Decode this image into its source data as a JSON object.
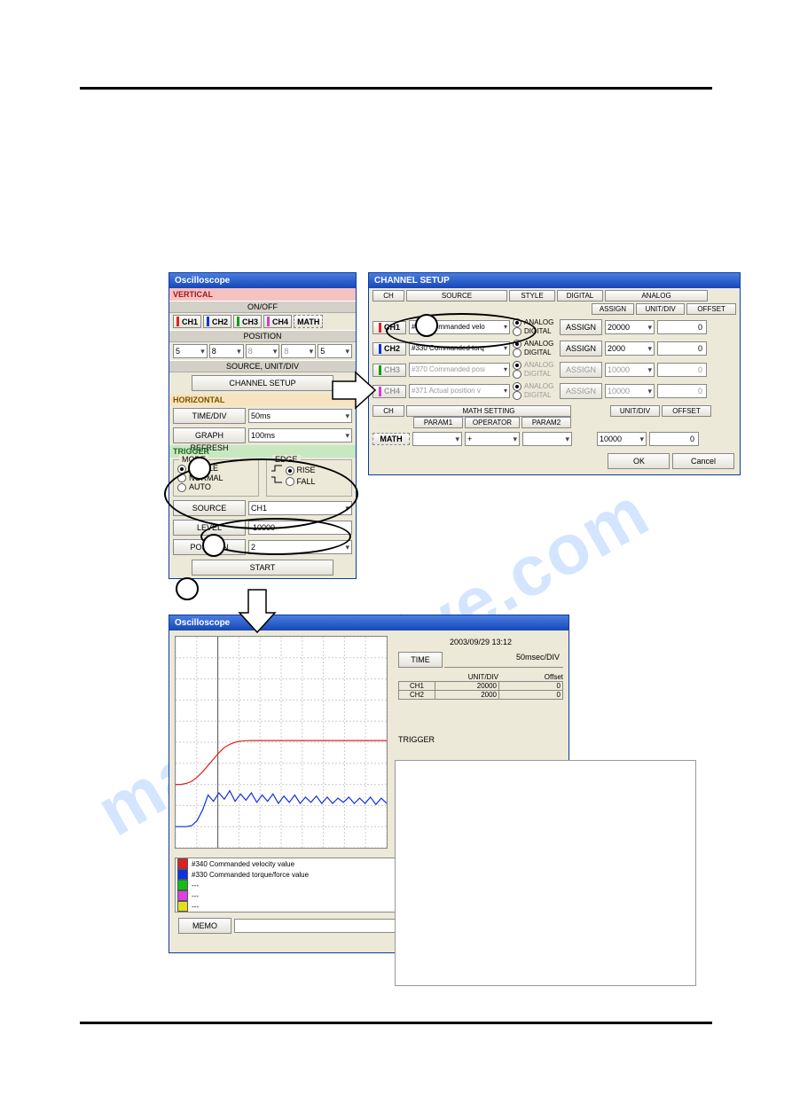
{
  "watermark": "manualshive.com",
  "osc_panel": {
    "title": "Oscilloscope",
    "vertical_label": "VERTICAL",
    "onoff_label": "ON/OFF",
    "ch_buttons": [
      "CH1",
      "CH2",
      "CH3",
      "CH4",
      "MATH"
    ],
    "position_label": "POSITION",
    "pos_values": [
      "5",
      "8",
      "8",
      "8",
      "5"
    ],
    "source_unitdiv_label": "SOURCE, UNIT/DIV",
    "channel_setup_btn": "CHANNEL SETUP",
    "horizontal_label": "HORIZONTAL",
    "time_div_label": "TIME/DIV",
    "time_div_value": "50ms",
    "graph_refresh_label": "GRAPH REFRESH",
    "graph_refresh_value": "100ms",
    "trigger_label": "TRIGGER",
    "mode_label": "MODE",
    "mode_single": "SINGLE",
    "mode_normal": "NORMAL",
    "mode_auto": "AUTO",
    "edge_label": "EDGE",
    "edge_rise": "RISE",
    "edge_fall": "FALL",
    "source_label": "SOURCE",
    "source_value": "CH1",
    "level_label": "LEVEL",
    "level_value": "10000",
    "position2_label": "POSITION",
    "position2_value": "2",
    "start_btn": "START"
  },
  "channel_setup": {
    "title": "CHANNEL SETUP",
    "headers": {
      "ch": "CH",
      "source": "SOURCE",
      "style": "STYLE",
      "digital": "DIGITAL",
      "analog": "ANALOG",
      "assign": "ASSIGN",
      "unitdiv": "UNIT/DIV",
      "offset": "OFFSET"
    },
    "rows": [
      {
        "ch": "CH1",
        "color": "#e02020",
        "src": "#340  Commanded velo",
        "style_analog": "ANALOG",
        "style_digital": "DIGITAL",
        "analog_on": true,
        "assign": "ASSIGN",
        "unitdiv": "20000",
        "offset": "0",
        "enabled": true
      },
      {
        "ch": "CH2",
        "color": "#1030e0",
        "src": "#330  Commanded torq",
        "style_analog": "ANALOG",
        "style_digital": "DIGITAL",
        "analog_on": true,
        "assign": "ASSIGN",
        "unitdiv": "2000",
        "offset": "0",
        "enabled": true
      },
      {
        "ch": "CH3",
        "color": "#10a010",
        "src": "#370  Commanded posi",
        "style_analog": "ANALOG",
        "style_digital": "DIGITAL",
        "analog_on": true,
        "assign": "ASSIGN",
        "unitdiv": "10000",
        "offset": "0",
        "enabled": false
      },
      {
        "ch": "CH4",
        "color": "#d040d0",
        "src": "#371  Actual position v",
        "style_analog": "ANALOG",
        "style_digital": "DIGITAL",
        "analog_on": true,
        "assign": "ASSIGN",
        "unitdiv": "10000",
        "offset": "0",
        "enabled": false
      }
    ],
    "math_headers": {
      "ch": "CH",
      "math_setting": "MATH SETTING",
      "param1": "PARAM1",
      "operator": "OPERATOR",
      "param2": "PARAM2",
      "unitdiv": "UNIT/DIV",
      "offset": "OFFSET"
    },
    "math_row": {
      "ch": "MATH",
      "param1": "",
      "operator": "+",
      "param2": "",
      "unitdiv": "10000",
      "offset": "0"
    },
    "ok_btn": "OK",
    "cancel_btn": "Cancel"
  },
  "scope_result": {
    "title": "Oscilloscope",
    "timestamp": "2003/09/29 13:12",
    "time_label": "TIME",
    "time_value": "50msec/DIV",
    "col_unitdiv": "UNIT/DIV",
    "col_offset": "Offset",
    "rows": [
      {
        "ch": "CH1",
        "unitdiv": "20000",
        "offset": "0"
      },
      {
        "ch": "CH2",
        "unitdiv": "2000",
        "offset": "0"
      }
    ],
    "trigger_label": "TRIGGER",
    "legend": [
      {
        "color": "#e02020",
        "text": "#340  Commanded velocity value"
      },
      {
        "color": "#1030e0",
        "text": "#330  Commanded torque/force value"
      },
      {
        "color": "#10c010",
        "text": "---"
      },
      {
        "color": "#e040e0",
        "text": "---"
      },
      {
        "color": "#e0e020",
        "text": "---"
      }
    ],
    "memo_label": "MEMO"
  },
  "chart_data": {
    "type": "line",
    "x": {
      "label": "",
      "range": [
        0,
        10
      ],
      "unit": "50msec/DIV",
      "gridlines": 10
    },
    "y": {
      "label": "",
      "range": [
        0,
        10
      ],
      "gridlines": 10
    },
    "trigger_position_div": 2,
    "series": [
      {
        "name": "CH1 #340 Commanded velocity value",
        "color": "#e02020",
        "unit_per_div": 20000,
        "offset": 0,
        "values_div": [
          3.0,
          3.0,
          3.05,
          3.15,
          3.35,
          3.6,
          3.9,
          4.2,
          4.5,
          4.75,
          4.9,
          5.0,
          5.05,
          5.07,
          5.08,
          5.08,
          5.08,
          5.08,
          5.08,
          5.08,
          5.08,
          5.08,
          5.08,
          5.08,
          5.08,
          5.08,
          5.08,
          5.08,
          5.08,
          5.08,
          5.08,
          5.08,
          5.08,
          5.08,
          5.08,
          5.08,
          5.08,
          5.08,
          5.08,
          5.08
        ]
      },
      {
        "name": "CH2 #330 Commanded torque/force value",
        "color": "#1030e0",
        "unit_per_div": 2000,
        "offset": 0,
        "values_div": [
          1.0,
          1.0,
          1.0,
          1.05,
          1.3,
          1.8,
          2.5,
          2.2,
          2.6,
          2.3,
          2.7,
          2.2,
          2.55,
          2.25,
          2.6,
          2.15,
          2.5,
          2.2,
          2.55,
          2.1,
          2.45,
          2.15,
          2.5,
          2.1,
          2.4,
          2.15,
          2.45,
          2.1,
          2.4,
          2.1,
          2.35,
          2.15,
          2.4,
          2.1,
          2.35,
          2.1,
          2.4,
          2.05,
          2.35,
          2.1
        ]
      }
    ]
  }
}
